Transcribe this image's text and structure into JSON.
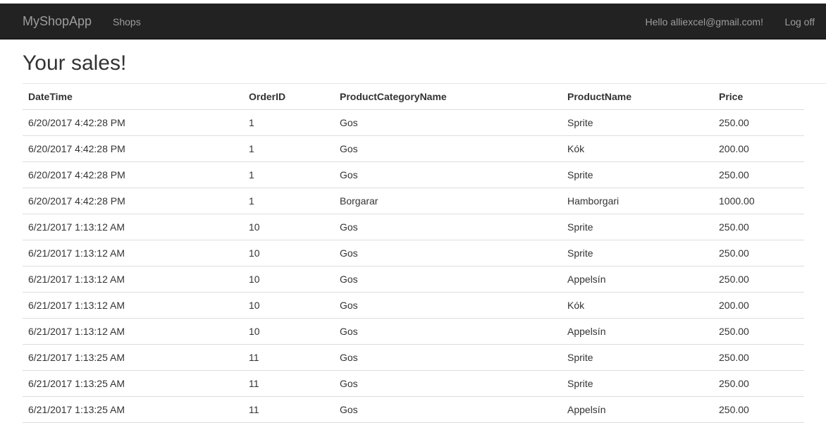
{
  "navbar": {
    "brand": "MyShopApp",
    "shops_link": "Shops",
    "greeting": "Hello alliexcel@gmail.com!",
    "logoff": "Log off"
  },
  "page": {
    "title": "Your sales!"
  },
  "table": {
    "headers": [
      "DateTime",
      "OrderID",
      "ProductCategoryName",
      "ProductName",
      "Price"
    ],
    "rows": [
      [
        "6/20/2017 4:42:28 PM",
        "1",
        "Gos",
        "Sprite",
        "250.00"
      ],
      [
        "6/20/2017 4:42:28 PM",
        "1",
        "Gos",
        "Kók",
        "200.00"
      ],
      [
        "6/20/2017 4:42:28 PM",
        "1",
        "Gos",
        "Sprite",
        "250.00"
      ],
      [
        "6/20/2017 4:42:28 PM",
        "1",
        "Borgarar",
        "Hamborgari",
        "1000.00"
      ],
      [
        "6/21/2017 1:13:12 AM",
        "10",
        "Gos",
        "Sprite",
        "250.00"
      ],
      [
        "6/21/2017 1:13:12 AM",
        "10",
        "Gos",
        "Sprite",
        "250.00"
      ],
      [
        "6/21/2017 1:13:12 AM",
        "10",
        "Gos",
        "Appelsín",
        "250.00"
      ],
      [
        "6/21/2017 1:13:12 AM",
        "10",
        "Gos",
        "Kók",
        "200.00"
      ],
      [
        "6/21/2017 1:13:12 AM",
        "10",
        "Gos",
        "Appelsín",
        "250.00"
      ],
      [
        "6/21/2017 1:13:25 AM",
        "11",
        "Gos",
        "Sprite",
        "250.00"
      ],
      [
        "6/21/2017 1:13:25 AM",
        "11",
        "Gos",
        "Sprite",
        "250.00"
      ],
      [
        "6/21/2017 1:13:25 AM",
        "11",
        "Gos",
        "Appelsín",
        "250.00"
      ]
    ]
  }
}
